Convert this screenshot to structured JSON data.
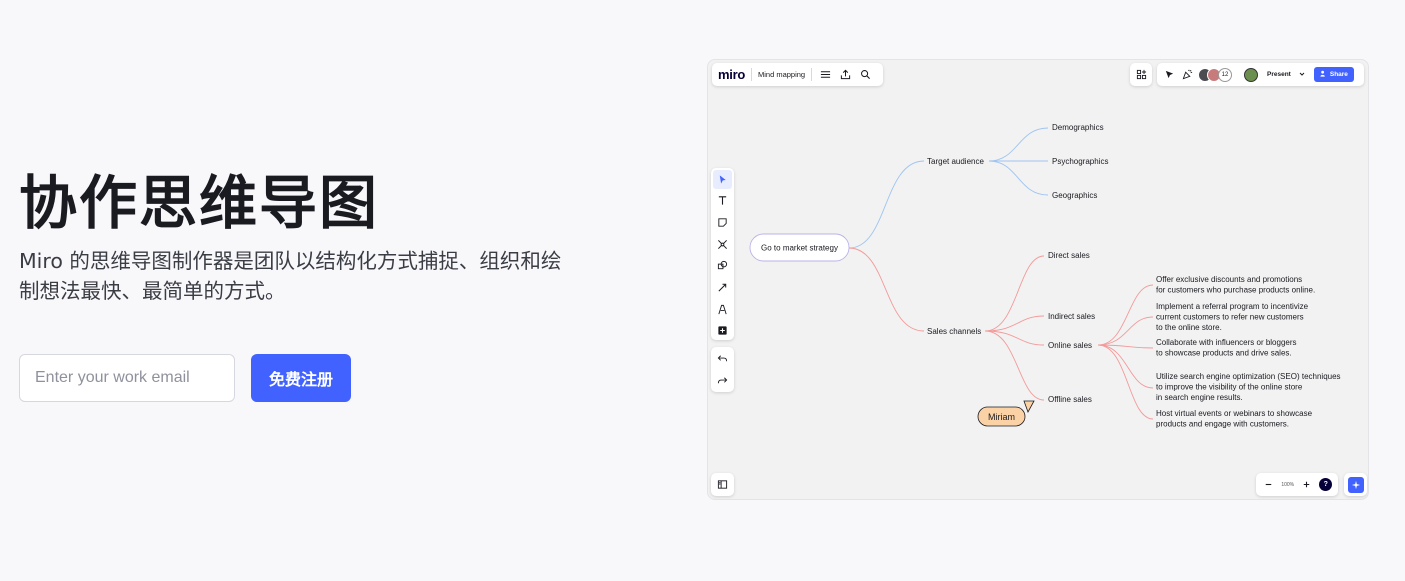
{
  "hero": {
    "title": "协作思维导图",
    "subtitle": "Miro 的思维导图制作器是团队以结构化方式捕捉、组织和绘制想法最快、最简单的方式。",
    "email_placeholder": "Enter your work email",
    "signup_label": "免费注册"
  },
  "board": {
    "logo": "miro",
    "board_name": "Mind mapping",
    "toolbar_icons": [
      "menu-icon",
      "upload-icon",
      "search-icon"
    ],
    "avatar_count": "12",
    "present_label": "Present",
    "share_label": "Share",
    "tools": [
      "cursor-icon",
      "text-icon",
      "sticky-note-icon",
      "frame-icon",
      "shapes-icon",
      "connector-icon",
      "pen-icon",
      "plus-icon"
    ],
    "zoom": "100%",
    "help": "?",
    "cursor_name": "Miriam",
    "colors": {
      "accent": "#4262ff",
      "blue_branch": "#9ec4f2",
      "red_branch": "#f39a9a",
      "cursor_tag": "#fbd2a5"
    },
    "mindmap": {
      "root": "Go to market strategy",
      "branches": [
        {
          "label": "Target audience",
          "children": [
            "Demographics",
            "Psychographics",
            "Geographics"
          ]
        },
        {
          "label": "Sales channels",
          "children": [
            "Direct sales",
            "Indirect sales",
            "Online sales",
            "Offline sales"
          ]
        }
      ],
      "online_sales_ideas": [
        [
          "Offer exclusive discounts and promotions",
          "for customers who purchase products online."
        ],
        [
          "Implement a referral program to incentivize",
          "current customers to refer new customers",
          "to the online store."
        ],
        [
          "Collaborate with influencers or bloggers",
          "to showcase products and drive sales."
        ],
        [
          "Utilize search engine optimization (SEO) techniques",
          "to improve the visibility of the online store",
          "in search engine results."
        ],
        [
          "Host virtual events or webinars to showcase",
          "products and engage with customers."
        ]
      ]
    }
  }
}
